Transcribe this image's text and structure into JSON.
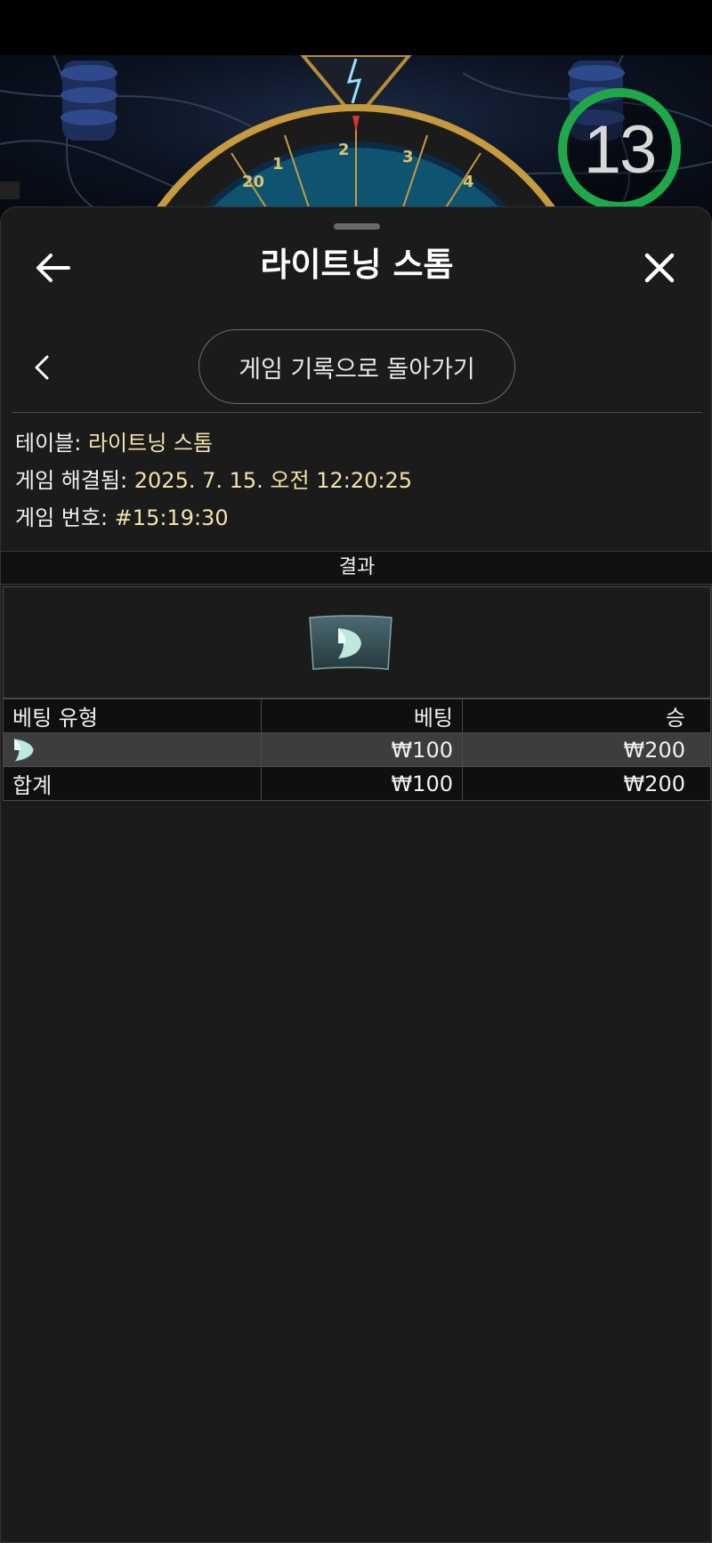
{
  "timer": {
    "value": "13",
    "ring_color": "#1fa84a"
  },
  "header": {
    "title": "라이트닝 스톰"
  },
  "nav": {
    "history_button_label": "게임 기록으로 돌아가기"
  },
  "info": {
    "table_label": "테이블:",
    "table_value": "라이트닝 스톰",
    "resolved_label": "게임 해결됨:",
    "resolved_value": "2025. 7. 15. 오전 12:20:25",
    "game_no_label": "게임 번호:",
    "game_no_value": "#15:19:30"
  },
  "result": {
    "heading": "결과",
    "tile_icon": "leaf-bet-icon"
  },
  "bets": {
    "columns": [
      "베팅 유형",
      "베팅",
      "승"
    ],
    "rows": [
      {
        "type_icon": "leaf-bet-icon",
        "bet": "₩100",
        "win": "₩200"
      }
    ],
    "total": {
      "label": "합계",
      "bet": "₩100",
      "win": "₩200"
    }
  },
  "colors": {
    "accent_value": "#f3e2a9",
    "sheet_bg": "#1b1b1b"
  }
}
